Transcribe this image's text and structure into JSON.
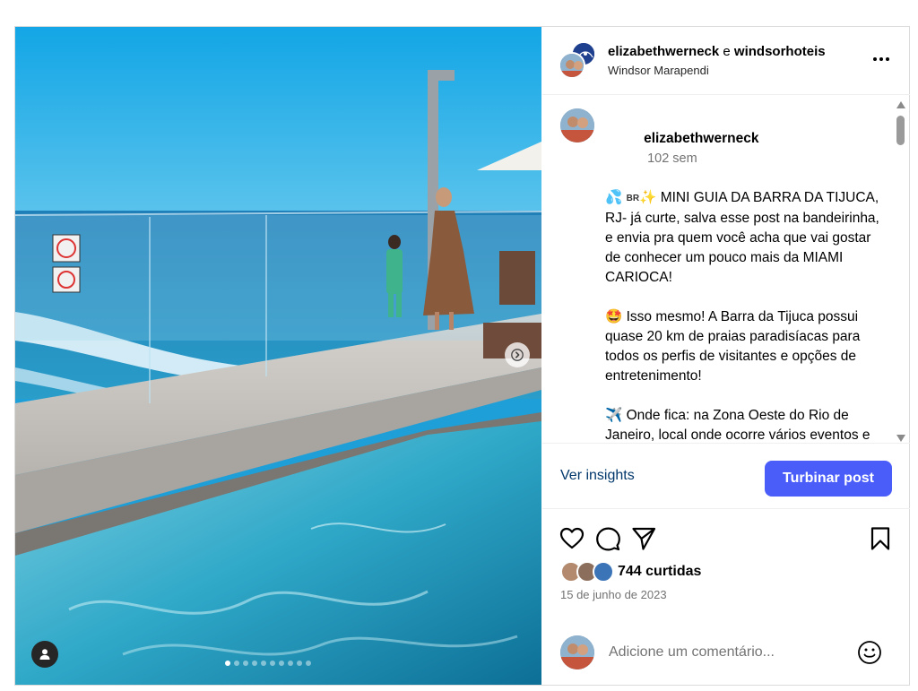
{
  "post": {
    "author": "elizabethwerneck",
    "connector": "e",
    "coauthor": "windsorhoteis",
    "location": "Windsor Marapendi"
  },
  "caption": {
    "username": "elizabethwerneck",
    "time": "102 sem",
    "badge": "BR",
    "intro": "MINI GUIA DA BARRA DA TIJUCA, RJ- já curte, salva esse post na bandeirinha, e envia pra quem você acha que vai gostar de conhecer um pouco mais da MIAMI CARIOCA!",
    "para2": "Isso mesmo! A Barra da Tijuca possui quase 20 km de praias paradisíacas para todos os perfis de visitantes e opções de entretenimento!",
    "para3": "Onde fica: na Zona Oeste do Rio de Janeiro, local onde ocorre vários eventos e shows. O bairro não lembra em nada a Cidade Maravilhosa, é como se você estivesse em outra cidade (em"
  },
  "insights": {
    "link_label": "Ver insights",
    "boost_label": "Turbinar post"
  },
  "likes_label": "744 curtidas",
  "date": "15 de junho de 2023",
  "comment": {
    "placeholder": "Adicione um comentário..."
  },
  "carousel": {
    "total_slides": 10,
    "current_slide": 1
  },
  "icons": {
    "like": "heart-icon",
    "comment": "comment-icon",
    "share": "send-icon",
    "save": "bookmark-icon",
    "more": "more-icon",
    "emoji": "emoji-icon",
    "tag": "user-tag-icon",
    "next": "chevron-right-icon"
  },
  "colors": {
    "accent": "#4a5df9",
    "link": "#00376b",
    "muted": "#737373",
    "divider": "#efefef"
  }
}
